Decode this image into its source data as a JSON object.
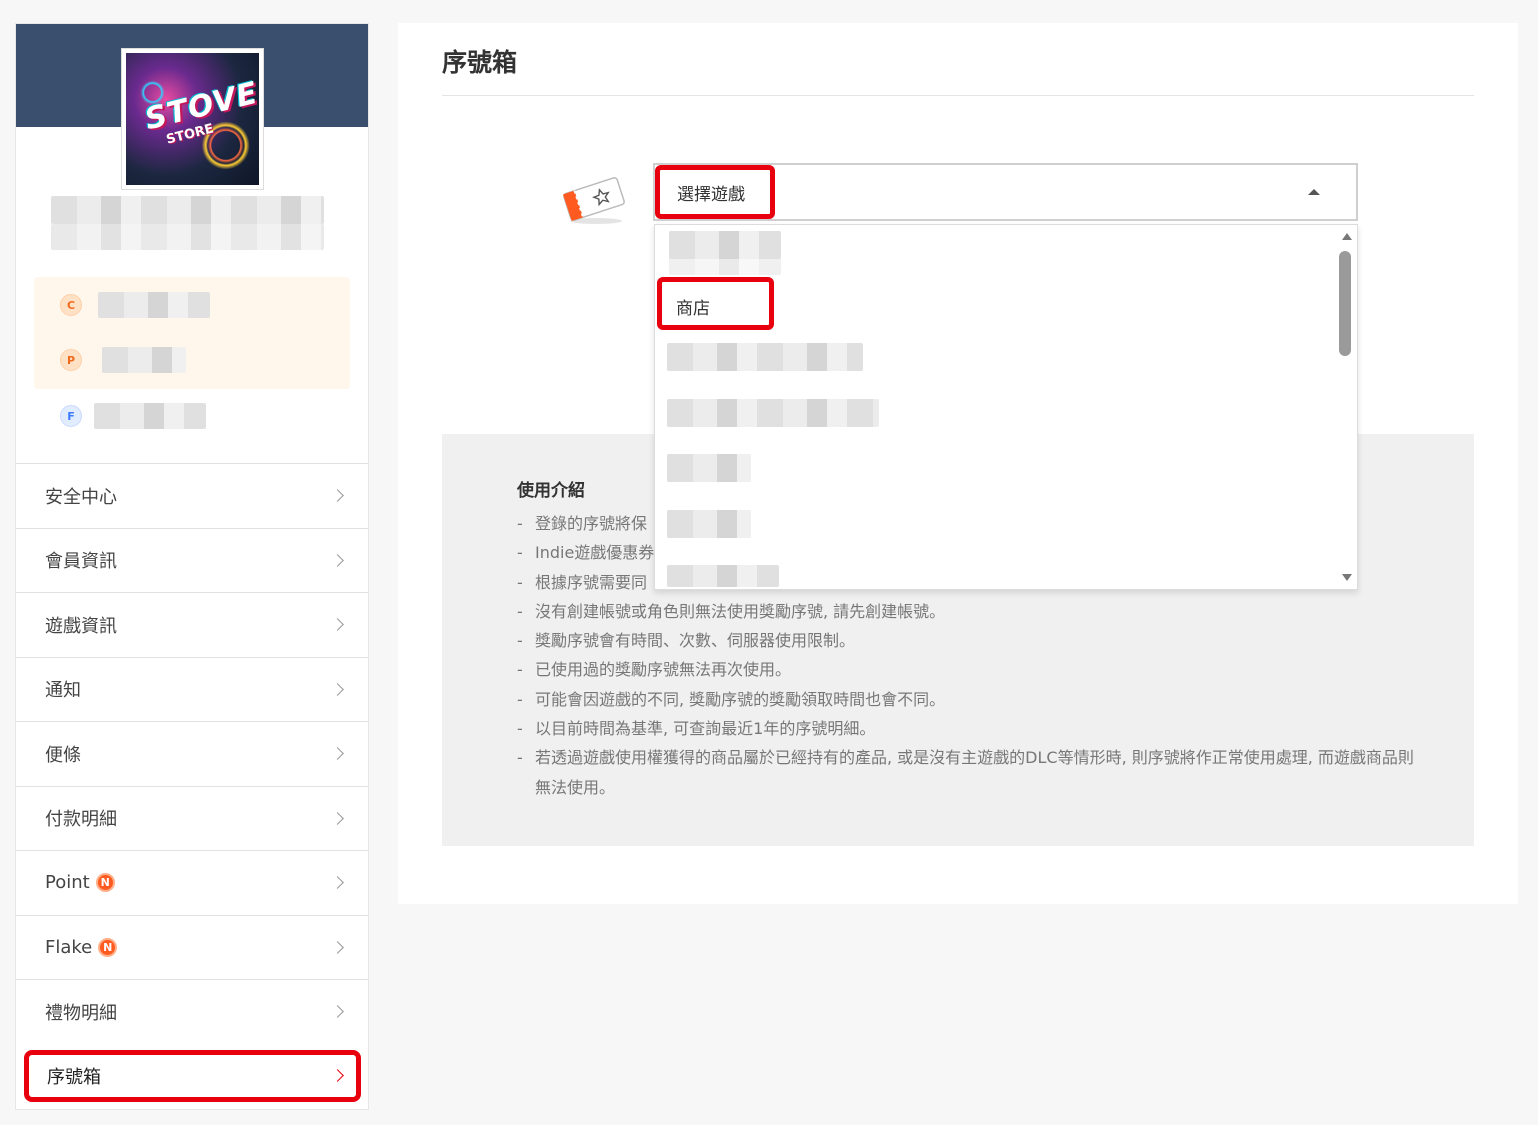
{
  "sidebar": {
    "avatar": {
      "logo_text": "STOVE",
      "logo_sub": "STORE"
    },
    "currencies": [
      {
        "icon": "C"
      },
      {
        "icon": "P"
      },
      {
        "icon": "F"
      }
    ],
    "menu": [
      {
        "label": "安全中心"
      },
      {
        "label": "會員資訊"
      },
      {
        "label": "遊戲資訊"
      },
      {
        "label": "通知"
      },
      {
        "label": "便條"
      },
      {
        "label": "付款明細"
      },
      {
        "label": "Point",
        "badge": "N"
      },
      {
        "label": "Flake",
        "badge": "N"
      },
      {
        "label": "禮物明細"
      },
      {
        "label": "序號箱",
        "active": true
      }
    ]
  },
  "main": {
    "title": "序號箱",
    "select": {
      "value": "選擇遊戲"
    },
    "dropdown": {
      "visible_option": "商店"
    },
    "info": {
      "title": "使用介紹",
      "items": [
        "登錄的序號將保",
        "Indie遊戲優惠券",
        "根據序號需要同",
        "沒有創建帳號或角色則無法使用獎勵序號, 請先創建帳號。",
        "獎勵序號會有時間、次數、伺服器使用限制。",
        "已使用過的獎勵序號無法再次使用。",
        "可能會因遊戲的不同, 獎勵序號的獎勵領取時間也會不同。",
        "以目前時間為基準, 可查詢最近1年的序號明細。",
        "若透過遊戲使用權獲得的商品屬於已經持有的產品, 或是沒有主遊戲的DLC等情形時, 則序號將作正常使用處理, 而遊戲商品則無法使用。"
      ]
    }
  },
  "colors": {
    "accent_red": "#e8000f",
    "banner": "#3a4f6e",
    "badge": "#ff5a1f"
  }
}
